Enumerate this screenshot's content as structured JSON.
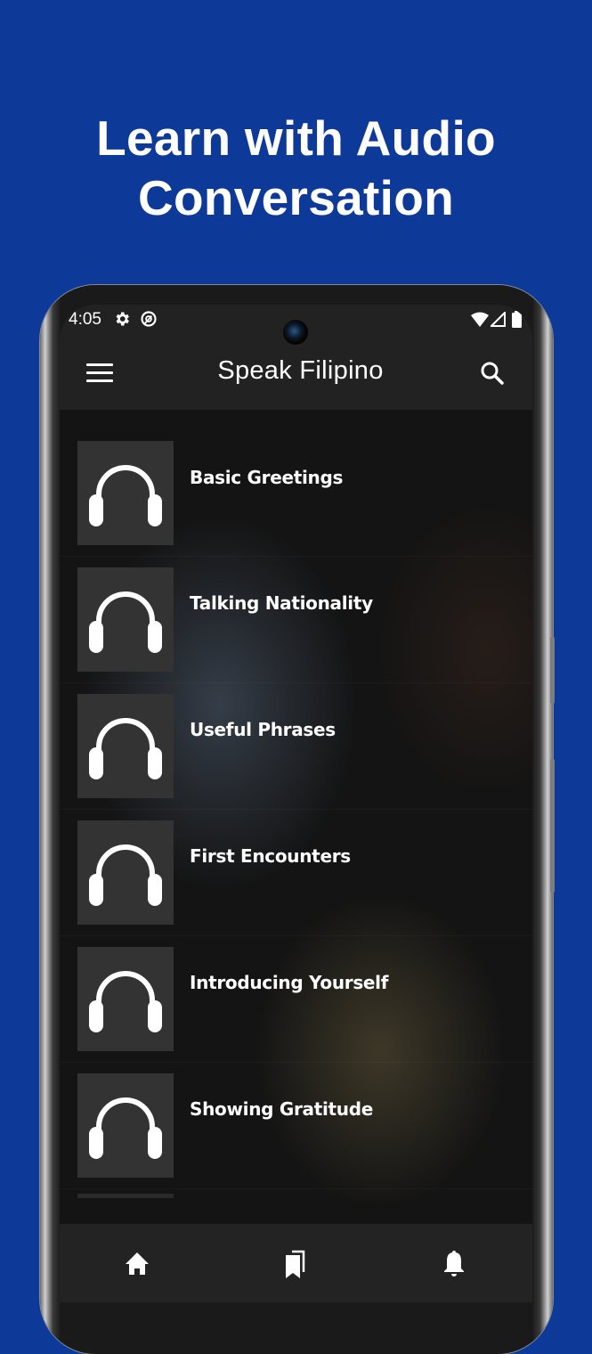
{
  "promo": {
    "headline_line1": "Learn with Audio",
    "headline_line2": "Conversation",
    "background_color": "#0d3a99"
  },
  "statusbar": {
    "time": "4:05",
    "left_icons": [
      "settings-icon",
      "data-saver-icon"
    ],
    "right_icons": [
      "wifi-icon",
      "signal-icon",
      "battery-icon"
    ]
  },
  "appbar": {
    "title": "Speak Filipino",
    "menu_icon": "hamburger-menu-icon",
    "search_icon": "search-icon"
  },
  "lessons": [
    {
      "title": "Basic Greetings",
      "icon": "headphones-icon"
    },
    {
      "title": "Talking Nationality",
      "icon": "headphones-icon"
    },
    {
      "title": "Useful Phrases",
      "icon": "headphones-icon"
    },
    {
      "title": "First Encounters",
      "icon": "headphones-icon"
    },
    {
      "title": "Introducing Yourself",
      "icon": "headphones-icon"
    },
    {
      "title": "Showing Gratitude",
      "icon": "headphones-icon"
    }
  ],
  "bottom_nav": [
    {
      "name": "home",
      "icon": "home-icon"
    },
    {
      "name": "bookmarks",
      "icon": "bookmarks-icon"
    },
    {
      "name": "notifications",
      "icon": "bell-icon"
    }
  ]
}
